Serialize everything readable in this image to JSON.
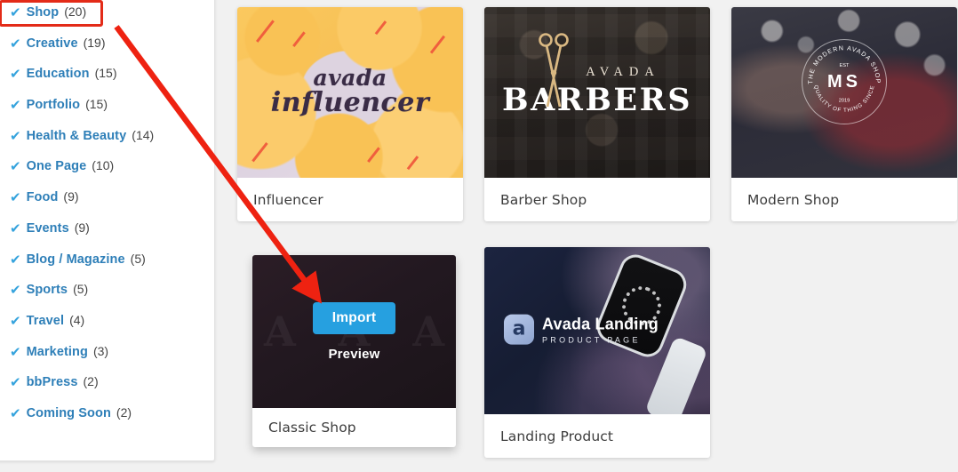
{
  "sidebar": {
    "name": "template-category-filter",
    "check_icon": "✔",
    "items": [
      {
        "label": "Shop",
        "count": "(20)",
        "selected": true
      },
      {
        "label": "Creative",
        "count": "(19)",
        "selected": false
      },
      {
        "label": "Education",
        "count": "(15)",
        "selected": false
      },
      {
        "label": "Portfolio",
        "count": "(15)",
        "selected": false
      },
      {
        "label": "Health & Beauty",
        "count": "(14)",
        "selected": false
      },
      {
        "label": "One Page",
        "count": "(10)",
        "selected": false
      },
      {
        "label": "Food",
        "count": "(9)",
        "selected": false
      },
      {
        "label": "Events",
        "count": "(9)",
        "selected": false
      },
      {
        "label": "Blog / Magazine",
        "count": "(5)",
        "selected": false
      },
      {
        "label": "Sports",
        "count": "(5)",
        "selected": false
      },
      {
        "label": "Travel",
        "count": "(4)",
        "selected": false
      },
      {
        "label": "Marketing",
        "count": "(3)",
        "selected": false
      },
      {
        "label": "bbPress",
        "count": "(2)",
        "selected": false
      },
      {
        "label": "Coming Soon",
        "count": "(2)",
        "selected": false
      }
    ]
  },
  "cards": [
    {
      "title": "Influencer",
      "thumb_kind": "influencer",
      "thumb_text": {
        "line1": "avada",
        "line2": "influencer"
      },
      "hovered": false
    },
    {
      "title": "Barber Shop",
      "thumb_kind": "barber",
      "thumb_text": {
        "line1": "AVADA",
        "line2": "BARBERS"
      },
      "hovered": false
    },
    {
      "title": "Modern Shop",
      "thumb_kind": "modern",
      "thumb_text": {
        "monogram": "MS",
        "ring_top": "THE MODERN AVADA SHOP",
        "ring_bottom": "QUALITY OF THING SINCE",
        "est": "EST",
        "year": "2019"
      },
      "hovered": false
    },
    {
      "title": "Classic Shop",
      "thumb_kind": "classic",
      "thumb_text": {
        "watermark": "A"
      },
      "hovered": true
    },
    {
      "title": "Landing Product",
      "thumb_kind": "landing",
      "thumb_text": {
        "line1": "Avada Landing",
        "line2": "PRODUCT PAGE",
        "mark": "a"
      },
      "hovered": false
    }
  ],
  "hover_overlay": {
    "import_label": "Import",
    "preview_label": "Preview"
  },
  "annotation": {
    "arrow_color": "#ee2211",
    "highlight_color": "#e32b18",
    "arrow_from": "Shop (20) filter",
    "arrow_to": "Classic Shop Import button"
  },
  "colors": {
    "page_background": "#f1f1f1",
    "panel_background": "#ffffff",
    "filter_label": "#2e7fb8",
    "filter_check": "#35a3dd",
    "filter_count": "#444444",
    "import_button": "#26a0e0",
    "card_title": "#3d3d3d"
  }
}
